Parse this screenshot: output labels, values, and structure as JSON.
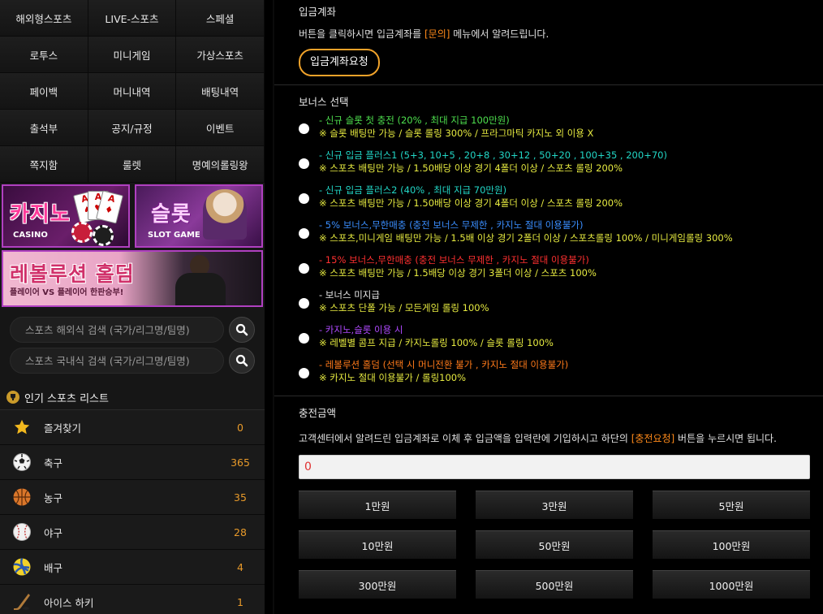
{
  "nav": [
    {
      "label": "해외형스포츠"
    },
    {
      "label": "LIVE-스포츠"
    },
    {
      "label": "스페셜"
    },
    {
      "label": "로투스"
    },
    {
      "label": "미니게임"
    },
    {
      "label": "가상스포츠"
    },
    {
      "label": "페이백"
    },
    {
      "label": "머니내역"
    },
    {
      "label": "배팅내역"
    },
    {
      "label": "출석부"
    },
    {
      "label": "공지/규정"
    },
    {
      "label": "이벤트"
    },
    {
      "label": "쪽지함"
    },
    {
      "label": "룰렛"
    },
    {
      "label": "명예의롤링왕"
    }
  ],
  "banners": {
    "casino": {
      "title": "카지노",
      "sub": "CASINO"
    },
    "slot": {
      "title": "슬롯",
      "sub": "SLOT GAME"
    },
    "holdem": {
      "title": "레볼루션 홀덤",
      "sub": "플레이어 VS 플레이어 한판승부!"
    }
  },
  "search": {
    "overseas_placeholder": "스포츠 해외식 검색 (국가/리그명/팀명)",
    "domestic_placeholder": "스포츠 국내식 검색 (국가/리그명/팀명)"
  },
  "sports": {
    "heading": "인기 스포츠 리스트",
    "items": [
      {
        "name": "즐겨찾기",
        "count": "0",
        "icon": "star-icon"
      },
      {
        "name": "축구",
        "count": "365",
        "icon": "soccer-ball-icon"
      },
      {
        "name": "농구",
        "count": "35",
        "icon": "basketball-icon"
      },
      {
        "name": "야구",
        "count": "28",
        "icon": "baseball-icon"
      },
      {
        "name": "배구",
        "count": "4",
        "icon": "volleyball-icon"
      },
      {
        "name": "아이스 하키",
        "count": "1",
        "icon": "hockey-icon"
      }
    ]
  },
  "deposit_account": {
    "title": "입금계좌",
    "desc_before": "버튼을 클릭하시면 입금계좌를 ",
    "desc_highlight": "[문의]",
    "desc_after": " 메뉴에서 알려드립니다.",
    "button": "입금계좌요청"
  },
  "bonus": {
    "title": "보너스 선택",
    "options": [
      {
        "line1": "- 신규 슬롯 첫 충전 (20% , 최대 지급 100만원)",
        "line2": "※ 슬롯 배팅만 가능 / 슬롯 롤링 300% / 프라그마틱 카지노 외 이용 X",
        "color": "#4ee04e"
      },
      {
        "line1": "- 신규 입금 플러스1 (5+3, 10+5 , 20+8 , 30+12 , 50+20 , 100+35 , 200+70)",
        "line2": "※ 스포츠 배팅만 가능 / 1.50배당 이상 경기 4폴더 이상 / 스포츠 롤링 200%",
        "color": "#22d6c6"
      },
      {
        "line1": "- 신규 입금 플러스2 (40% , 최대 지급 70만원)",
        "line2": "※ 스포츠 배팅만 가능 / 1.50배당 이상 경기 4폴더 이상 / 스포츠 롤링 200%",
        "color": "#22d6c6"
      },
      {
        "line1": "- 5% 보너스,무한매충 (충전 보너스 무제한 , 카지노 절대 이용불가)",
        "line2": "※ 스포츠,미니게임 배팅만 가능 / 1.5배 이상 경기 2폴더 이상 / 스포츠롤링 100% / 미니게임롤링 300%",
        "color": "#3a8eff"
      },
      {
        "line1": "- 15% 보너스,무한매충 (충전 보너스 무제한 , 카지노 절대 이용불가)",
        "line2": "※ 스포츠 배팅만 가능 / 1.5배당 이상 경기 3폴더 이상 / 스포츠 100%",
        "color": "#ff3030"
      },
      {
        "line1": "- 보너스 미지급",
        "line2": "※ 스포츠 단폴 가능 / 모든게임 롤링 100%",
        "color": "#e8e8e8"
      },
      {
        "line1": "- 카지노,슬롯 이용 시",
        "line2": "※ 레벨별 콤프 지급 / 카지노롤링 100% / 슬롯 롤링 100%",
        "color": "#b04aff"
      },
      {
        "line1": "- 레볼루션 홀덤 (선택 시 머니전환 불가 , 카지노 절대 이용불가)",
        "line2": "※ 카지노 절대 이용불가 / 롤링100%",
        "color": "#ff7a1a"
      }
    ]
  },
  "charge": {
    "title": "충전금액",
    "desc_before": "고객센터에서 알려드린 입금계좌로 이체 후 입금액을 입력란에 기입하시고 하단의 ",
    "desc_highlight": "[충전요청]",
    "desc_after": " 버튼을 누르시면 됩니다.",
    "amount_value": "0",
    "buttons": [
      {
        "label": "1만원"
      },
      {
        "label": "3만원"
      },
      {
        "label": "5만원"
      },
      {
        "label": "10만원"
      },
      {
        "label": "50만원"
      },
      {
        "label": "100만원"
      },
      {
        "label": "300만원"
      },
      {
        "label": "500만원"
      },
      {
        "label": "1000만원"
      }
    ]
  },
  "colors": {
    "accent": "#f0a22a",
    "highlight": "#ff8a1a",
    "count": "#e89a2a"
  }
}
